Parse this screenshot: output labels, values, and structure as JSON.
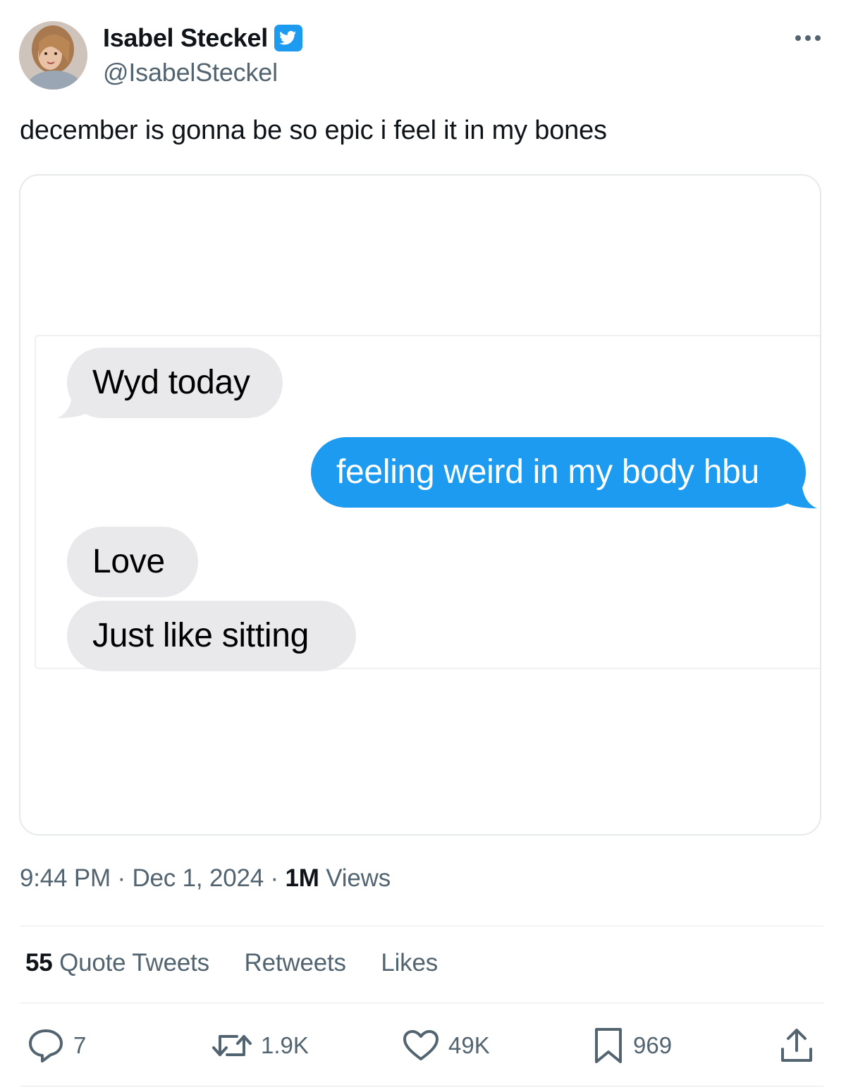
{
  "author": {
    "display_name": "Isabel Steckel",
    "handle": "@IsabelSteckel",
    "verified": true
  },
  "tweet": {
    "text": "december is gonna be so epic i feel it in my bones",
    "time": "9:44 PM",
    "date": "Dec 1, 2024",
    "views_count": "1M",
    "views_label": "Views"
  },
  "screenshot_messages": [
    {
      "sender": "them",
      "text": "Wyd today"
    },
    {
      "sender": "me",
      "text": "feeling weird in my body hbu"
    },
    {
      "sender": "them",
      "text": "Love"
    },
    {
      "sender": "them",
      "text": "Just like sitting"
    }
  ],
  "stats": {
    "quote_tweets_count": "55",
    "quote_tweets_label": "Quote Tweets",
    "retweets_label": "Retweets",
    "likes_label": "Likes"
  },
  "actions": {
    "replies": "7",
    "retweets": "1.9K",
    "likes": "49K",
    "bookmarks": "969"
  },
  "colors": {
    "accent": "#1d9bf0",
    "incoming_bubble": "#e9e9eb",
    "secondary_text": "#536471"
  },
  "icons": [
    "avatar",
    "verified-badge-icon",
    "more-icon",
    "reply-icon",
    "retweet-icon",
    "like-icon",
    "bookmark-icon",
    "share-icon"
  ]
}
